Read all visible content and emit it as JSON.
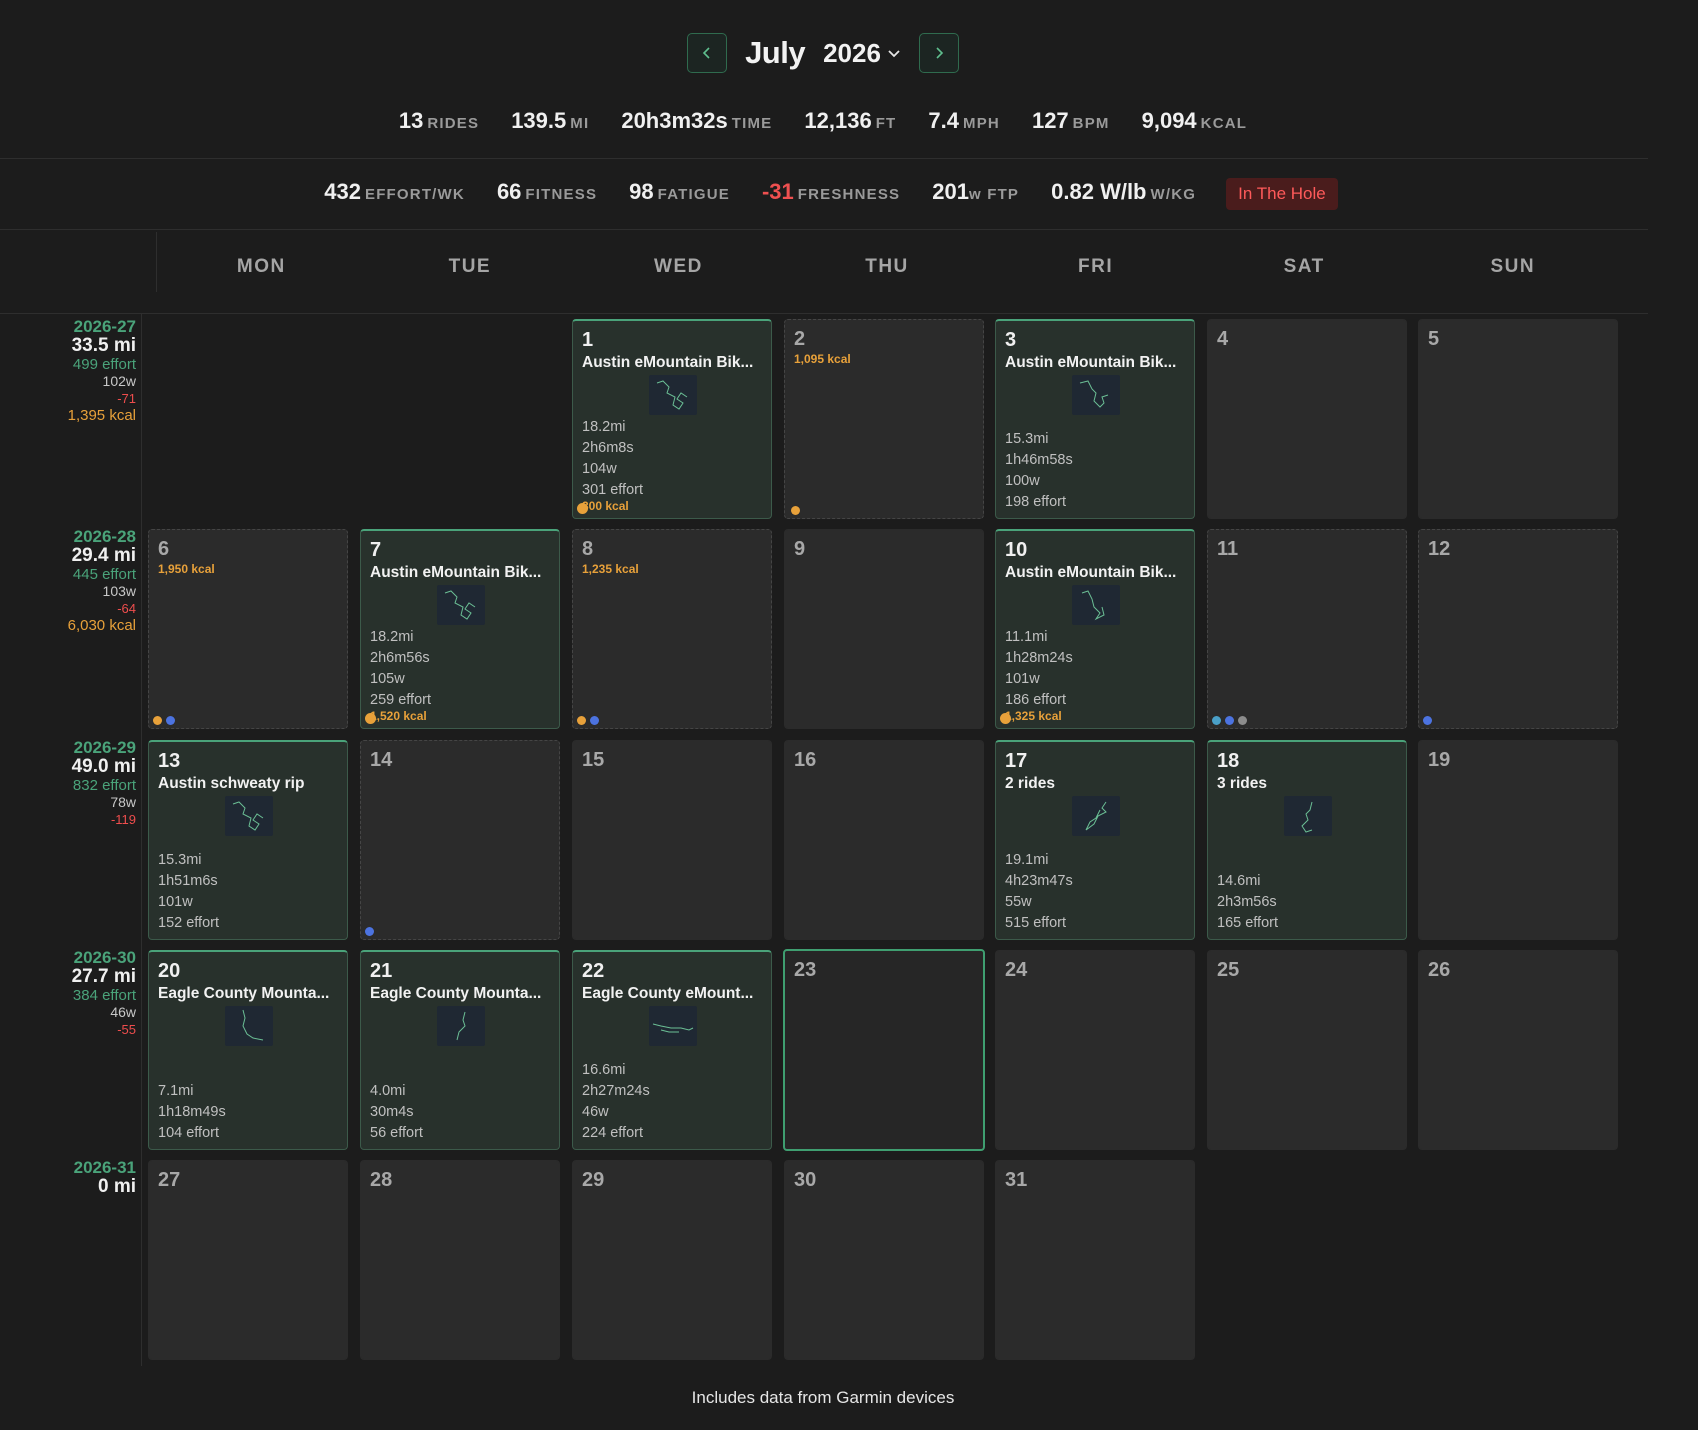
{
  "header": {
    "month": "July",
    "year": "2026"
  },
  "stats_row1": [
    {
      "value": "13",
      "unit": "RIDES"
    },
    {
      "value": "139.5",
      "unit": "MI"
    },
    {
      "value": "20h3m32s",
      "unit": "TIME"
    },
    {
      "value": "12,136",
      "unit": "FT"
    },
    {
      "value": "7.4",
      "unit": "MPH"
    },
    {
      "value": "127",
      "unit": "BPM"
    },
    {
      "value": "9,094",
      "unit": "KCAL"
    }
  ],
  "stats_row2": [
    {
      "value": "432",
      "unit": "EFFORT/WK"
    },
    {
      "value": "66",
      "unit": "FITNESS"
    },
    {
      "value": "98",
      "unit": "FATIGUE"
    },
    {
      "value": "-31",
      "unit": "FRESHNESS"
    },
    {
      "value": "201",
      "unit": "w FTP"
    },
    {
      "value": "0.82 W/lb",
      "unit": "W/KG"
    }
  ],
  "status_badge": "In The Hole",
  "colors": {
    "accent": "#4aa37a",
    "negative": "#ee5050",
    "kcal": "#e8a13a"
  },
  "days_of_week": [
    "MON",
    "TUE",
    "WED",
    "THU",
    "FRI",
    "SAT",
    "SUN"
  ],
  "weeks": [
    {
      "id": "2026-27",
      "miles": "33.5 mi",
      "effort": "499 effort",
      "watts": "102w",
      "freshness": "-71",
      "kcal": "1,395 kcal"
    },
    {
      "id": "2026-28",
      "miles": "29.4 mi",
      "effort": "445 effort",
      "watts": "103w",
      "freshness": "-64",
      "kcal": "6,030 kcal"
    },
    {
      "id": "2026-29",
      "miles": "49.0 mi",
      "effort": "832 effort",
      "watts": "78w",
      "freshness": "-119",
      "kcal": ""
    },
    {
      "id": "2026-30",
      "miles": "27.7 mi",
      "effort": "384 effort",
      "watts": "46w",
      "freshness": "-55",
      "kcal": ""
    },
    {
      "id": "2026-31",
      "miles": "0 mi",
      "effort": "",
      "watts": "",
      "freshness": "",
      "kcal": ""
    }
  ],
  "days": {
    "d1": {
      "num": "1",
      "title": "Austin eMountain Bik...",
      "lines": [
        "18.2mi",
        "2h6m8s",
        "104w",
        "301 effort"
      ],
      "kcal": "300 kcal"
    },
    "d2": {
      "num": "2",
      "kcal": "1,095 kcal"
    },
    "d3": {
      "num": "3",
      "title": "Austin eMountain Bik...",
      "lines": [
        "15.3mi",
        "1h46m58s",
        "100w",
        "198 effort"
      ]
    },
    "d4": {
      "num": "4"
    },
    "d5": {
      "num": "5"
    },
    "d6": {
      "num": "6",
      "kcal": "1,950 kcal"
    },
    "d7": {
      "num": "7",
      "title": "Austin eMountain Bik...",
      "lines": [
        "18.2mi",
        "2h6m56s",
        "105w",
        "259 effort"
      ],
      "kcal": "1,520 kcal"
    },
    "d8": {
      "num": "8",
      "kcal": "1,235 kcal"
    },
    "d9": {
      "num": "9"
    },
    "d10": {
      "num": "10",
      "title": "Austin eMountain Bik...",
      "lines": [
        "11.1mi",
        "1h28m24s",
        "101w",
        "186 effort"
      ],
      "kcal": "1,325 kcal"
    },
    "d11": {
      "num": "11"
    },
    "d12": {
      "num": "12"
    },
    "d13": {
      "num": "13",
      "title": "Austin schweaty rip",
      "lines": [
        "15.3mi",
        "1h51m6s",
        "101w",
        "152 effort"
      ]
    },
    "d14": {
      "num": "14"
    },
    "d15": {
      "num": "15"
    },
    "d16": {
      "num": "16"
    },
    "d17": {
      "num": "17",
      "title": "2 rides",
      "lines": [
        "19.1mi",
        "4h23m47s",
        "55w",
        "515 effort"
      ]
    },
    "d18": {
      "num": "18",
      "title": "3 rides",
      "lines": [
        "14.6mi",
        "2h3m56s",
        "165 effort"
      ]
    },
    "d19": {
      "num": "19"
    },
    "d20": {
      "num": "20",
      "title": "Eagle County Mounta...",
      "lines": [
        "7.1mi",
        "1h18m49s",
        "104 effort"
      ]
    },
    "d21": {
      "num": "21",
      "title": "Eagle County Mounta...",
      "lines": [
        "4.0mi",
        "30m4s",
        "56 effort"
      ]
    },
    "d22": {
      "num": "22",
      "title": "Eagle County eMount...",
      "lines": [
        "16.6mi",
        "2h27m24s",
        "46w",
        "224 effort"
      ]
    },
    "d23": {
      "num": "23"
    },
    "d24": {
      "num": "24"
    },
    "d25": {
      "num": "25"
    },
    "d26": {
      "num": "26"
    },
    "d27": {
      "num": "27"
    },
    "d28": {
      "num": "28"
    },
    "d29": {
      "num": "29"
    },
    "d30": {
      "num": "30"
    },
    "d31": {
      "num": "31"
    }
  },
  "footer": "Includes data from Garmin devices"
}
